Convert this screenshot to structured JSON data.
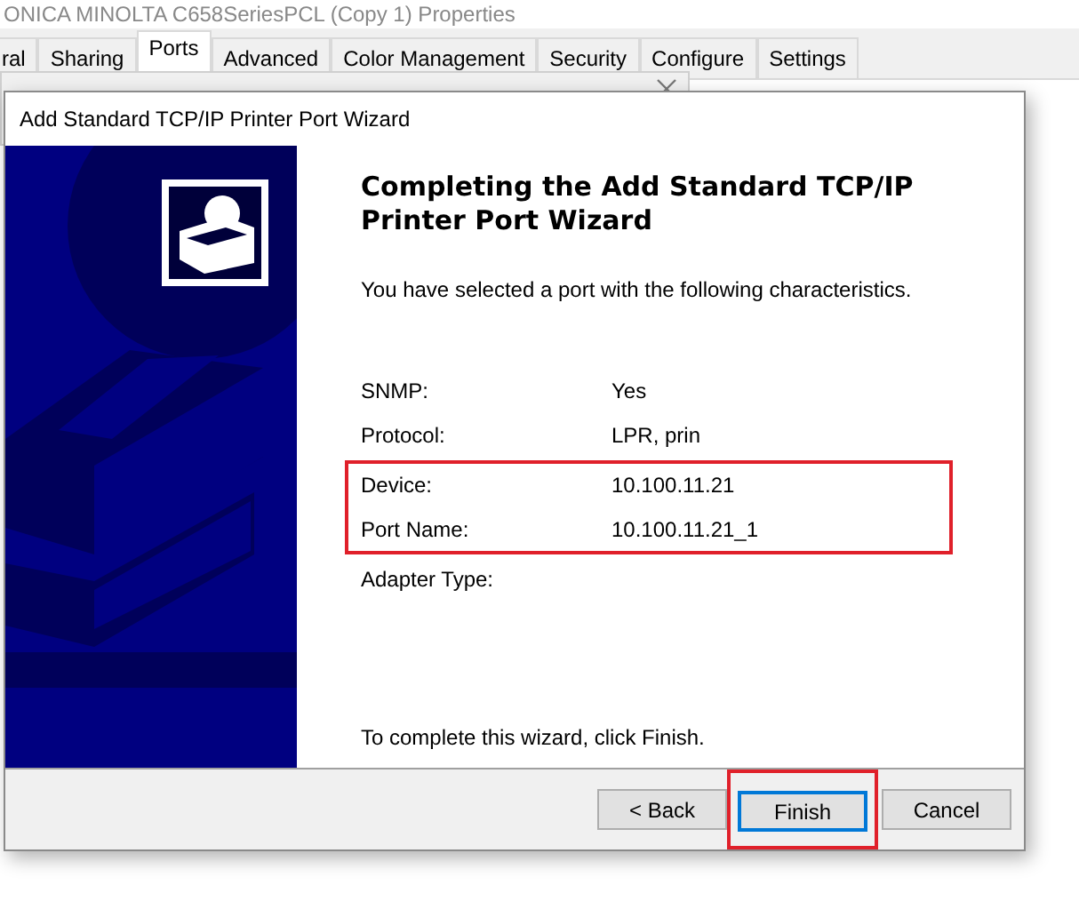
{
  "properties_window": {
    "title": "ONICA MINOLTA C658SeriesPCL (Copy 1) Properties"
  },
  "tabs": [
    {
      "label": "ral",
      "selected": false
    },
    {
      "label": "Sharing",
      "selected": false
    },
    {
      "label": "Ports",
      "selected": true
    },
    {
      "label": "Advanced",
      "selected": false
    },
    {
      "label": "Color Management",
      "selected": false
    },
    {
      "label": "Security",
      "selected": false
    },
    {
      "label": "Configure",
      "selected": false
    },
    {
      "label": "Settings",
      "selected": false
    }
  ],
  "wizard": {
    "title": "Add Standard TCP/IP Printer Port Wizard",
    "heading": "Completing the Add Standard TCP/IP Printer Port Wizard",
    "intro": "You have selected a port with the following characteristics.",
    "rows": [
      {
        "label": "SNMP:",
        "value": "Yes",
        "highlighted": false
      },
      {
        "label": "Protocol:",
        "value": "LPR, prin",
        "highlighted": false
      },
      {
        "label": "Device:",
        "value": "10.100.11.21",
        "highlighted": true
      },
      {
        "label": "Port Name:",
        "value": "10.100.11.21_1",
        "highlighted": true
      },
      {
        "label": "Adapter Type:",
        "highlighted": false
      }
    ],
    "footer_note": "To complete this wizard, click Finish.",
    "buttons": [
      {
        "label": "< Back",
        "default": false,
        "highlighted": false
      },
      {
        "label": "Finish",
        "default": true,
        "highlighted": true
      },
      {
        "label": "Cancel",
        "default": false,
        "highlighted": false
      }
    ]
  }
}
